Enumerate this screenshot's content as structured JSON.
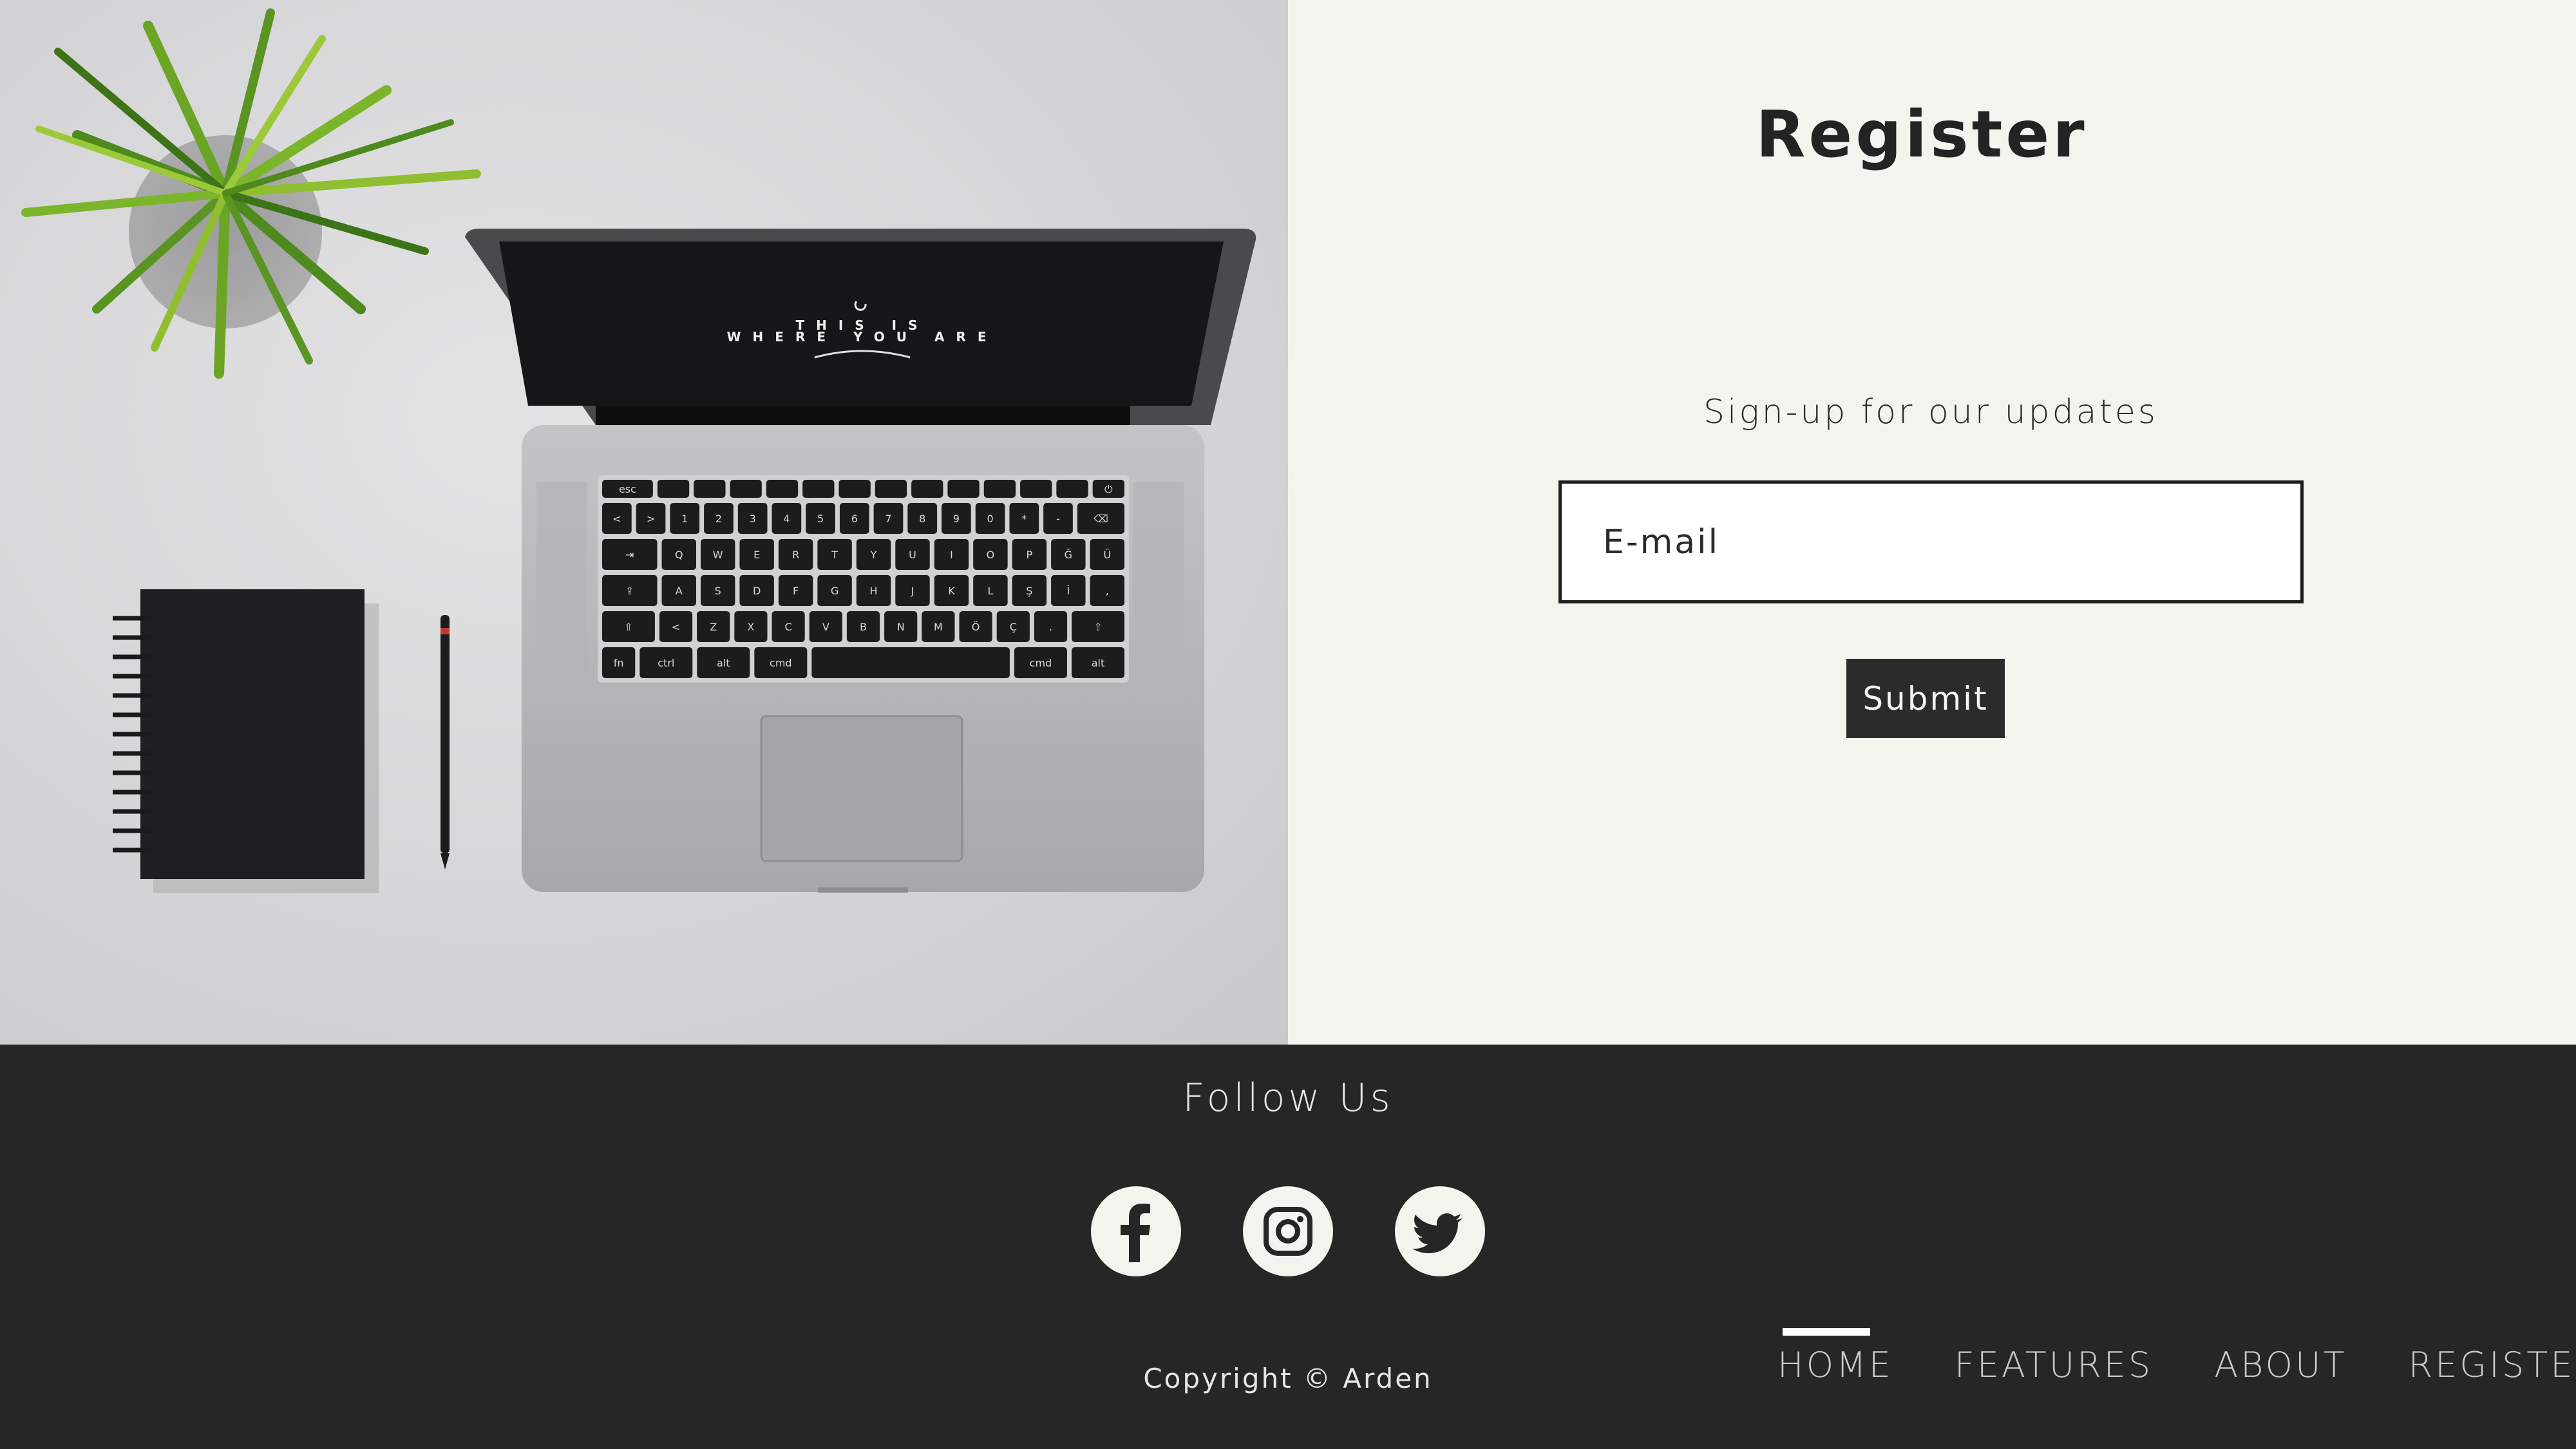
{
  "photo": {
    "screen_text_line1": "THIS IS",
    "screen_text_line2": "WHERE YOU ARE",
    "keyboard_rows": [
      [
        "esc",
        "",
        "",
        "",
        "",
        "",
        "",
        "",
        "",
        "",
        "",
        "",
        "",
        "⏻"
      ],
      [
        "<",
        ">",
        "1",
        "2",
        "3",
        "4",
        "5",
        "6",
        "7",
        "8",
        "9",
        "0",
        "*",
        "-",
        "⌫"
      ],
      [
        "⇥",
        "Q",
        "W",
        "E",
        "R",
        "T",
        "Y",
        "U",
        "I",
        "O",
        "P",
        "Ğ",
        "Ü"
      ],
      [
        "⇪",
        "A",
        "S",
        "D",
        "F",
        "G",
        "H",
        "J",
        "K",
        "L",
        "Ş",
        "İ",
        ","
      ],
      [
        "⇧",
        "<",
        "Z",
        "X",
        "C",
        "V",
        "B",
        "N",
        "M",
        "Ö",
        "Ç",
        ".",
        "⇧"
      ],
      [
        "fn",
        "ctrl",
        "alt",
        "cmd",
        "",
        "cmd",
        "alt"
      ]
    ]
  },
  "register": {
    "title": "Register",
    "subtitle": "Sign-up for our updates",
    "email_placeholder": "E-mail",
    "submit_label": "Submit"
  },
  "footer": {
    "follow_title": "Follow Us",
    "social": [
      {
        "name": "facebook-icon"
      },
      {
        "name": "instagram-icon"
      },
      {
        "name": "twitter-icon"
      }
    ],
    "copyright": "Copyright © Arden",
    "nav": [
      {
        "label": "HOME",
        "active": true
      },
      {
        "label": "FEATURES",
        "active": false
      },
      {
        "label": "ABOUT",
        "active": false
      },
      {
        "label": "REGISTER",
        "active": false
      }
    ]
  },
  "colors": {
    "footer_bg": "#262626",
    "panel_bg": "#f4f4ef",
    "button_bg": "#2b2b2b"
  }
}
